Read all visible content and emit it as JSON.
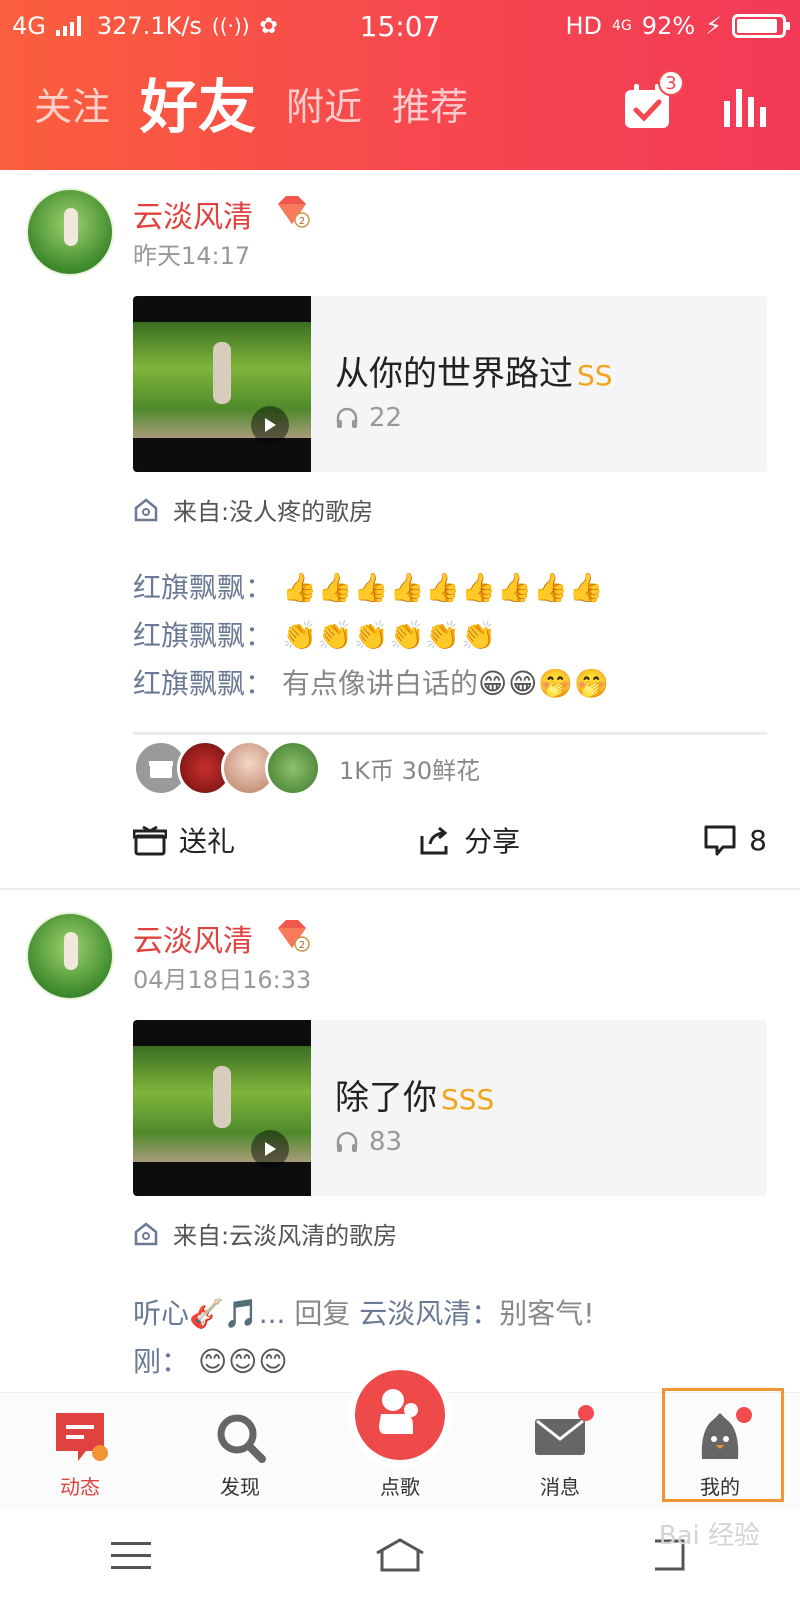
{
  "status": {
    "network": "4G",
    "speed": "327.1K/s",
    "time": "15:07",
    "hd": "HD",
    "net2": "4G",
    "battery": "92%"
  },
  "tabs": [
    {
      "label": "关注"
    },
    {
      "label": "好友"
    },
    {
      "label": "附近"
    },
    {
      "label": "推荐"
    }
  ],
  "header": {
    "calendar_badge": "3"
  },
  "posts": [
    {
      "user": "云淡风清",
      "vip_level": "2",
      "time": "昨天14:17",
      "song": {
        "title": "从你的世界路过",
        "tag": "SS",
        "plays": "22"
      },
      "from": "来自:没人疼的歌房",
      "comments": [
        {
          "who": "红旗飘飘",
          "sep": "：",
          "text": "",
          "emoji": "👍👍👍👍👍👍👍👍👍"
        },
        {
          "who": "红旗飘飘",
          "sep": "：",
          "text": "",
          "emoji": "👏👏👏👏👏👏"
        },
        {
          "who": "红旗飘飘",
          "sep": "：",
          "text": "有点像讲白话的",
          "emoji": "😁😁🤭🤭"
        }
      ],
      "gifts_text": "1K币  30鲜花",
      "actions": {
        "gift": "送礼",
        "share": "分享",
        "comments": "8"
      }
    },
    {
      "user": "云淡风清",
      "vip_level": "2",
      "time": "04月18日16:33",
      "song": {
        "title": "除了你",
        "tag": "SSS",
        "plays": "83"
      },
      "from": "来自:云淡风清的歌房",
      "comments": [
        {
          "who": "听心🎸🎵...",
          "reply": "回复",
          "target": "云淡风清",
          "sep": "：",
          "text": "别客气!"
        },
        {
          "who": "刚",
          "sep": "：",
          "emoji": "😊😊😊"
        }
      ]
    }
  ],
  "bottom_nav": [
    {
      "label": "动态"
    },
    {
      "label": "发现"
    },
    {
      "label": "点歌"
    },
    {
      "label": "消息"
    },
    {
      "label": "我的"
    }
  ],
  "watermark": "Bai 经验",
  "colors": {
    "header_start": "#fb5e3c",
    "header_end": "#f23a56",
    "accent": "#e0423f",
    "highlight": "#f29436"
  }
}
